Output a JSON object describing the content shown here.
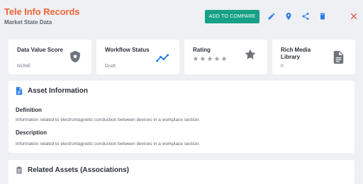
{
  "header": {
    "title": "Tele Info Records",
    "subtitle": "Market State Data",
    "add_to_compare": "ADD TO COMPARE"
  },
  "cards": [
    {
      "title": "Data Value Score",
      "value": "NONE",
      "icon": "shield-star-icon"
    },
    {
      "title": "Workflow Status",
      "value": "Draft",
      "icon": "trend-icon"
    },
    {
      "title": "Rating",
      "rating": 0,
      "icon": "star-icon"
    },
    {
      "title": "Rich Media Library",
      "value": "0",
      "icon": "document-icon"
    }
  ],
  "asset_info": {
    "title": "Asset Information",
    "definition_label": "Definition",
    "definition_text": "Information related to electromagnetic conduction between devices in a workplace section.",
    "description_label": "Description",
    "description_text": "Information related to electromagnetic conduction between devices in a workplace section."
  },
  "related": {
    "title": "Related Assets (Associations)"
  },
  "colors": {
    "accent": "#f0653a",
    "primary": "#16a085",
    "icon_blue": "#2b7de9",
    "close_red": "#e53935"
  }
}
